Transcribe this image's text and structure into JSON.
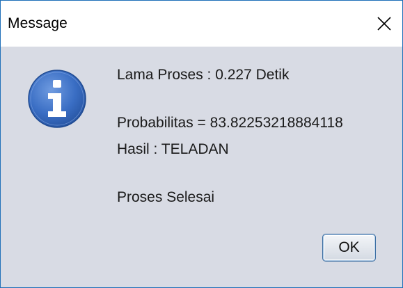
{
  "window": {
    "title": "Message",
    "close_icon": "close-icon"
  },
  "icon": {
    "name": "info-icon",
    "glyph": "i",
    "color": "#3a6ec4"
  },
  "message": {
    "lines": [
      "Lama Proses : 0.227 Detik",
      "Probabilitas = 83.82253218884118",
      "Hasil : TELADAN",
      "Proses Selesai"
    ]
  },
  "buttons": {
    "ok_label": "OK"
  },
  "colors": {
    "dialog_bg": "#d8dbe4",
    "titlebar_bg": "#ffffff",
    "border": "#1e6fb8",
    "button_border": "#3d6fa3"
  }
}
